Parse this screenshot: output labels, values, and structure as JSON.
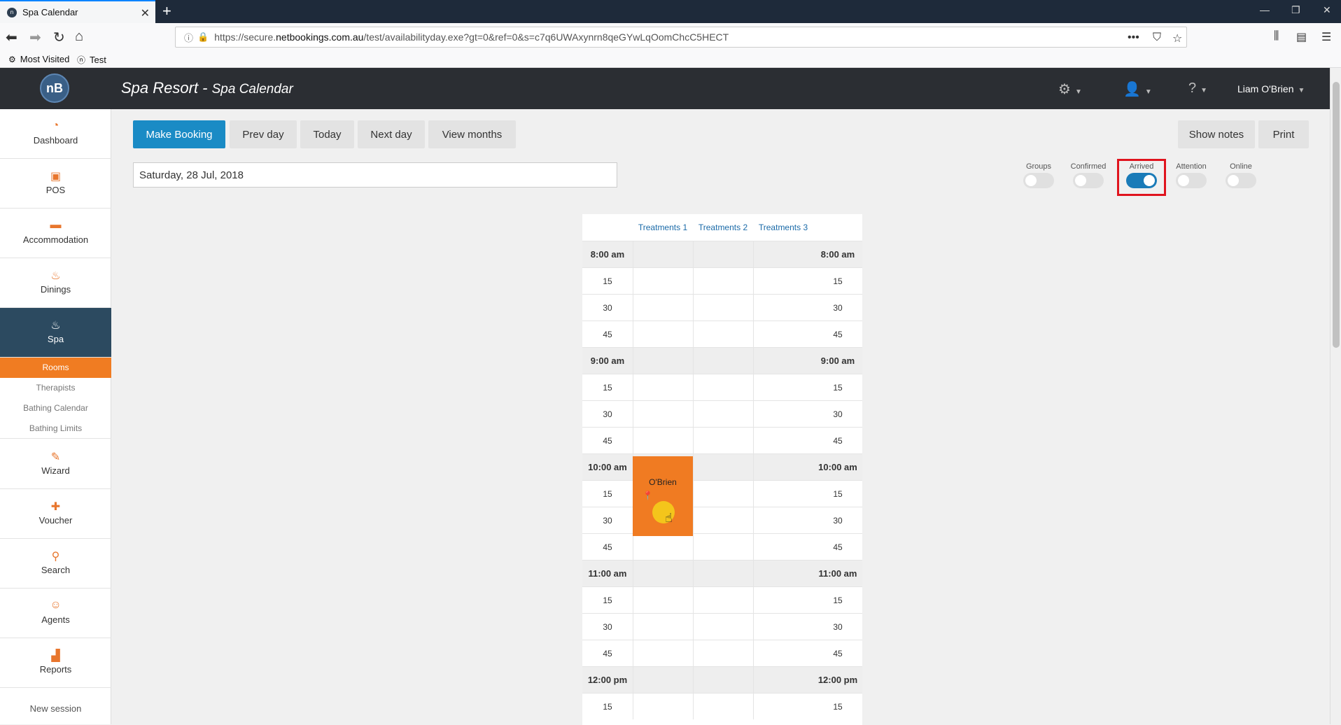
{
  "browser": {
    "tab_title": "Spa Calendar",
    "url_prefix": "https://secure.",
    "url_host": "netbookings.com.au",
    "url_rest": "/test/availabilityday.exe?gt=0&ref=0&s=c7q6UWAxynrn8qeGYwLqOomChcC5HECT",
    "bookmarks": [
      "Most Visited",
      "Test"
    ]
  },
  "app": {
    "logo": "nB",
    "title": "Spa Resort",
    "subtitle": "Spa Calendar",
    "user": "Liam O'Brien"
  },
  "sidebar": {
    "items": [
      {
        "label": "Dashboard",
        "icon": "gauge-icon"
      },
      {
        "label": "POS",
        "icon": "pos-icon"
      },
      {
        "label": "Accommodation",
        "icon": "bed-icon"
      },
      {
        "label": "Dinings",
        "icon": "dining-icon"
      },
      {
        "label": "Spa",
        "icon": "spa-icon"
      },
      {
        "label": "Wizard",
        "icon": "wand-icon"
      },
      {
        "label": "Voucher",
        "icon": "gift-icon"
      },
      {
        "label": "Search",
        "icon": "search-icon"
      },
      {
        "label": "Agents",
        "icon": "agent-icon"
      },
      {
        "label": "Reports",
        "icon": "chart-icon"
      }
    ],
    "spa_sub": [
      "Rooms",
      "Therapists",
      "Bathing Calendar",
      "Bathing Limits"
    ],
    "new_session": "New session"
  },
  "toolbar": {
    "make_booking": "Make Booking",
    "prev_day": "Prev day",
    "today": "Today",
    "next_day": "Next day",
    "view_months": "View months",
    "show_notes": "Show notes",
    "print": "Print"
  },
  "date_value": "Saturday, 28 Jul, 2018",
  "toggles": [
    {
      "label": "Groups",
      "on": false
    },
    {
      "label": "Confirmed",
      "on": false
    },
    {
      "label": "Arrived",
      "on": true
    },
    {
      "label": "Attention",
      "on": false
    },
    {
      "label": "Online",
      "on": false
    }
  ],
  "calendar": {
    "columns": [
      "Treatments 1",
      "Treatments 2",
      "Treatments 3"
    ],
    "times": [
      "8:00 am",
      "15",
      "30",
      "45",
      "9:00 am",
      "15",
      "30",
      "45",
      "10:00 am",
      "15",
      "30",
      "45",
      "11:00 am",
      "15",
      "30",
      "45",
      "12:00 pm",
      "15"
    ],
    "booking_name": "O'Brien"
  }
}
